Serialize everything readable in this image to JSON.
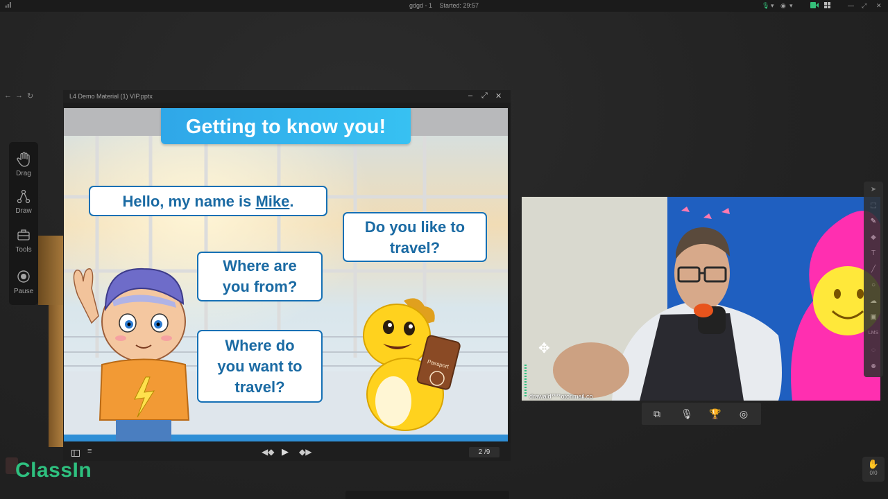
{
  "topbar": {
    "session_name": "gdgd - 1",
    "started_label": "Started: 29:57"
  },
  "toolbar": {
    "items": [
      {
        "label": "Drag",
        "icon": "hand-icon"
      },
      {
        "label": "Draw",
        "icon": "draw-icon"
      },
      {
        "label": "Tools",
        "icon": "toolbox-icon"
      },
      {
        "label": "Pause",
        "icon": "pause-icon"
      }
    ]
  },
  "ppt": {
    "filename": "L4 Demo Material (1) VIP.pptx",
    "page": "2 /9"
  },
  "slide": {
    "title": "Getting to know you!",
    "greeting_prefix": "Hello, my name is ",
    "greeting_name": "Mike",
    "greeting_suffix": ".",
    "q1_line1": "Where are",
    "q1_line2": "you from?",
    "q2_line1": "Where do",
    "q2_line2": "you want to",
    "q2_line3": "travel?",
    "q3_line1": "Do you like to",
    "q3_line2": "travel?",
    "passport_label": "Passport"
  },
  "video": {
    "user_label": "drawald****otonmail.co"
  },
  "logo": "ClassIn",
  "counter": "0/0",
  "colors": {
    "accent_green": "#2ec07f",
    "bubble_blue": "#1570b5",
    "banner_blue": "#2fa7e8"
  }
}
